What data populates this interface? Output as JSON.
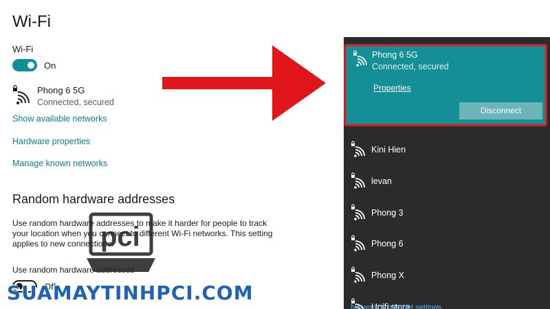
{
  "settings": {
    "title": "Wi-Fi",
    "wifi_label": "Wi-Fi",
    "wifi_toggle_state": "On",
    "current_network": {
      "name": "Phong 6 5G",
      "status": "Connected, secured"
    },
    "links": {
      "show_available": "Show available networks",
      "hardware_properties": "Hardware properties",
      "manage_known": "Manage known networks"
    },
    "random_hw": {
      "section_title": "Random hardware addresses",
      "description": "Use random hardware addresses to make it harder for people to track your location when you connect to different Wi-Fi networks. This setting applies to new connections.",
      "toggle_label": "Use random hardware addresses",
      "toggle_state": "Off"
    }
  },
  "flyout": {
    "active_network": {
      "name": "Phong 6 5G",
      "status": "Connected, secured",
      "properties_link": "Properties",
      "disconnect_label": "Disconnect"
    },
    "networks": [
      {
        "name": "Kini Hien"
      },
      {
        "name": "levan"
      },
      {
        "name": "Phong 3"
      },
      {
        "name": "Phong 6"
      },
      {
        "name": "Phong X"
      },
      {
        "name": "Unifi store"
      }
    ],
    "footer_text": "Network & Internet settings"
  },
  "watermark": {
    "text": "SUAMAYTINHPCI.COM",
    "logo_text": "pci"
  },
  "colors": {
    "accent": "#138f95",
    "highlight": "#e0161b",
    "flyout_bg": "#2b2b2b",
    "link": "#0f7f88"
  }
}
